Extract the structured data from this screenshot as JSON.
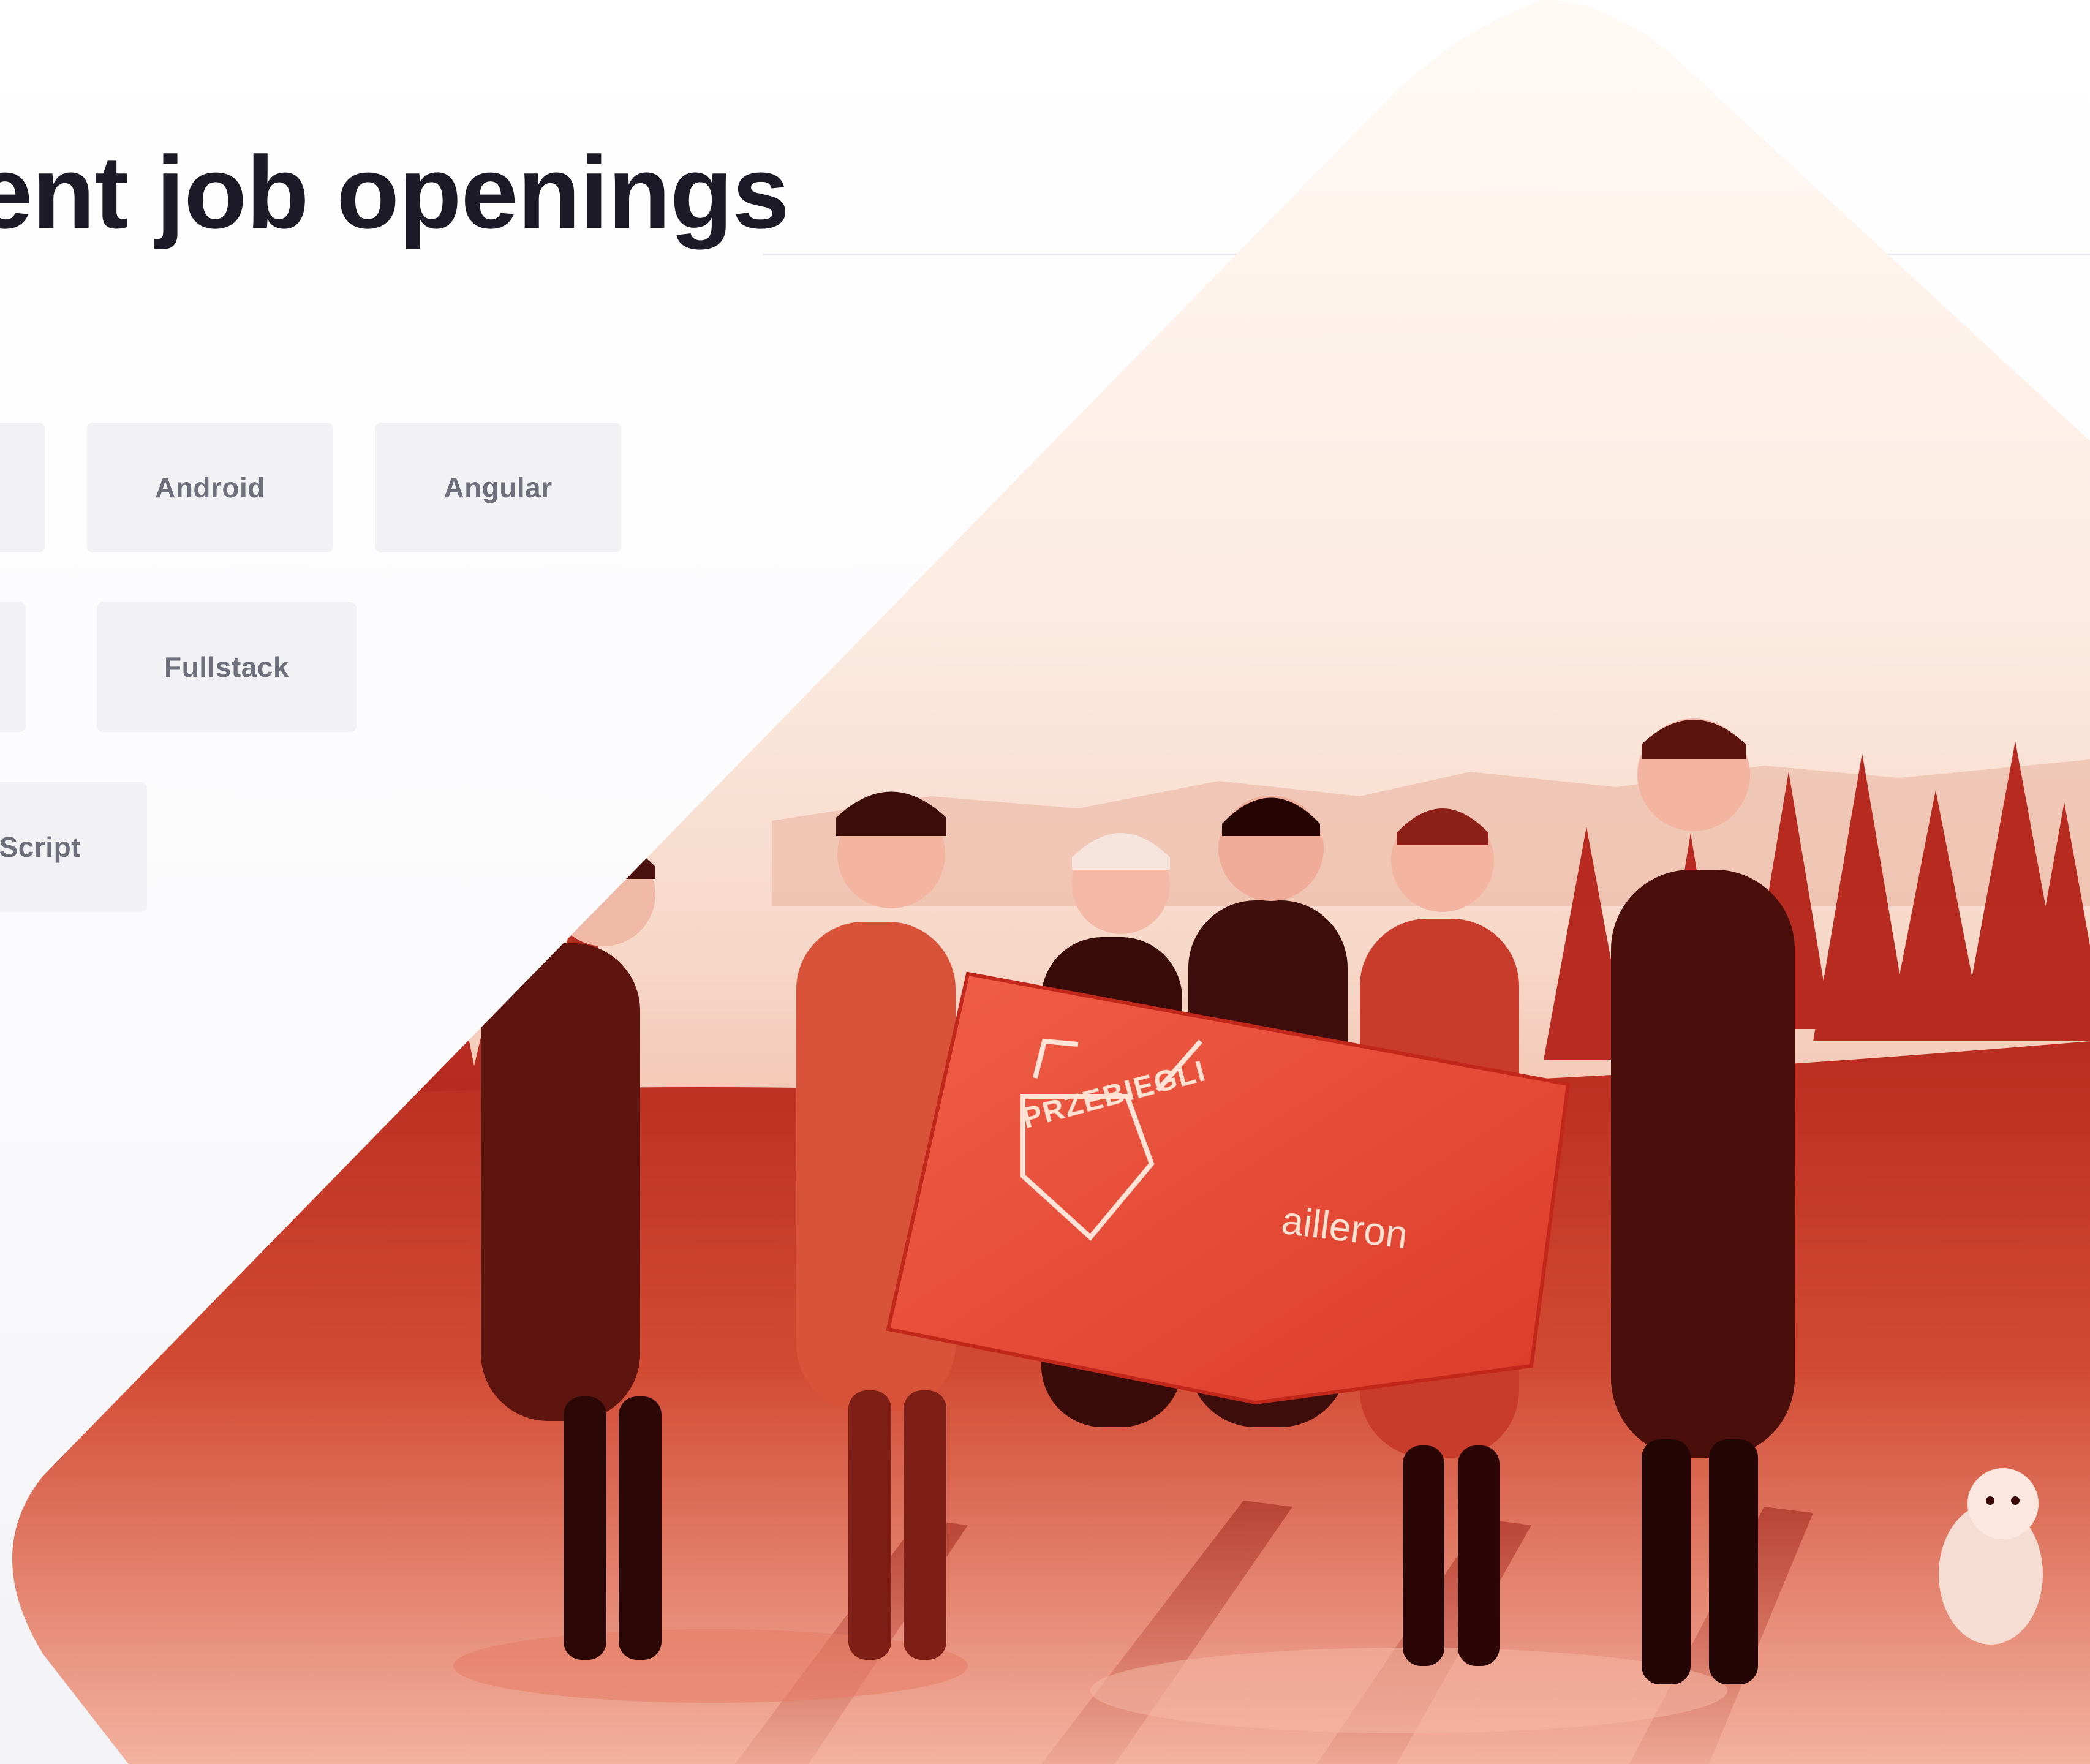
{
  "header": {
    "title": "ent job openings"
  },
  "job_tags": {
    "row1": [
      "Android",
      "Angular"
    ],
    "row2": [
      "Fullstack"
    ],
    "row3": [
      "Script"
    ]
  },
  "hero": {
    "flag_text": "PRZEBIEGLI",
    "company_text": "ailleron"
  },
  "colors": {
    "text_dark": "#1c1a26",
    "chip_bg": "#f2f2f5",
    "chip_text": "#6f6f7c",
    "photo_tint": "#c7391f",
    "photo_light": "#f9dfcf"
  }
}
